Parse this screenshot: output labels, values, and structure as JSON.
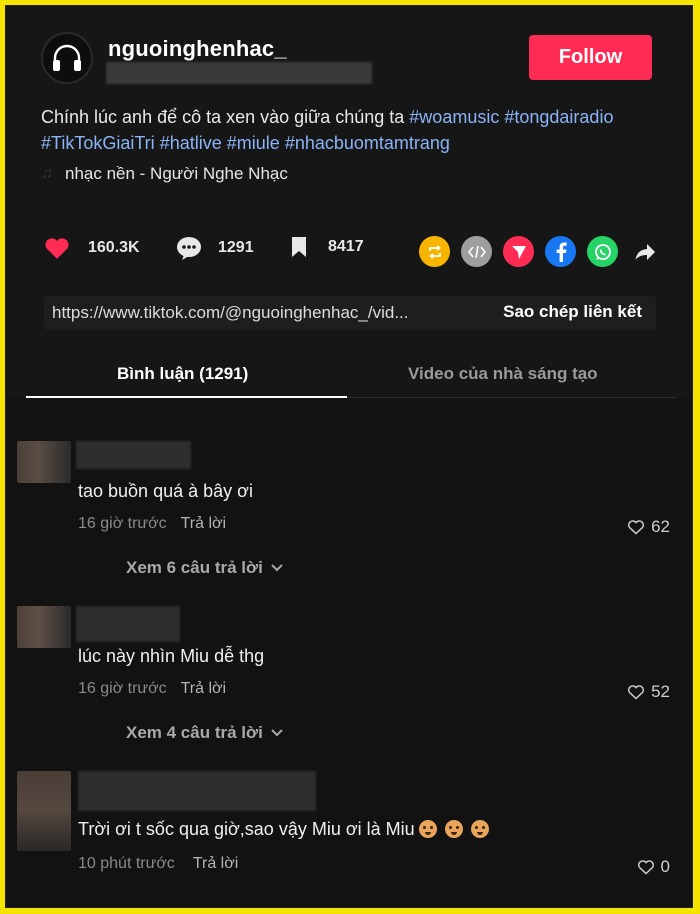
{
  "post": {
    "username": "nguoinghenhac_",
    "follow_label": "Follow",
    "caption_text": "Chính lúc anh để cô ta xen vào giữa chúng ta ",
    "hashtags": [
      "#woamusic",
      "#tongdairadio",
      "#TikTokGiaiTri",
      "#hatlive",
      "#miule",
      "#nhacbuomtamtrang"
    ],
    "music": "nhạc nền - Người Nghe Nhạc"
  },
  "actions": {
    "likes": "160.3K",
    "comments": "1291",
    "saves": "8417"
  },
  "share_colors": {
    "repost": "#f7b500",
    "embed": "#9e9e9e",
    "send": "#fe2c55",
    "facebook": "#1877f2",
    "whatsapp": "#25d366"
  },
  "link": {
    "url": "https://www.tiktok.com/@nguoinghenhac_/vid...",
    "copy_label": "Sao chép liên kết"
  },
  "tabs": [
    {
      "label": "Bình luận (1291)"
    },
    {
      "label": "Video của nhà sáng tạo"
    }
  ],
  "comments": [
    {
      "text": "tao buồn quá à bây ơi",
      "time": "16 giờ trước",
      "reply": "Trả lời",
      "likes": "62",
      "view_more": "Xem 6 câu trả lời"
    },
    {
      "text": "lúc này nhìn Miu dễ thg",
      "time": "16 giờ trước",
      "reply": "Trả lời",
      "likes": "52",
      "view_more": "Xem 4 câu trả lời"
    },
    {
      "text": "Trời ơi t sốc qua giờ,sao vậy Miu ơi là Miu",
      "time": "10 phút trước",
      "reply": "Trả lời",
      "likes": "0"
    }
  ]
}
